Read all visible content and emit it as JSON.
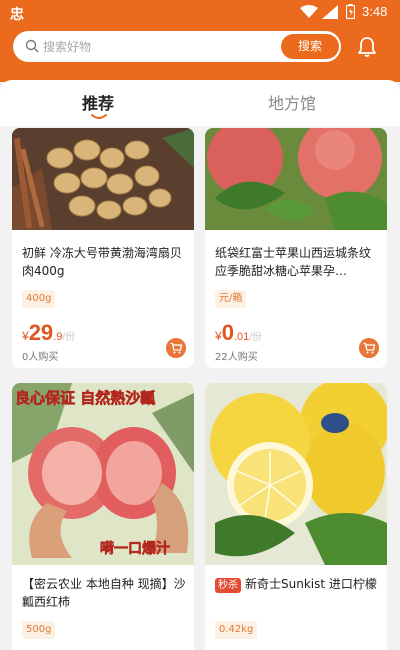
{
  "status_bar": {
    "time": "3:48",
    "app_glyph": "忠"
  },
  "search": {
    "placeholder": "搜索好物",
    "button_label": "搜索"
  },
  "tabs": [
    {
      "label": "推荐"
    },
    {
      "label": "地方馆"
    }
  ],
  "products": [
    {
      "name": "初鲜 冷冻大号带黄渤海湾扇贝肉400g",
      "spec": "400g",
      "price_symbol": "¥",
      "price_int": "29",
      "price_dec": ".9",
      "price_unit": "/份",
      "buyers": "0人购买"
    },
    {
      "name": "纸袋红富士苹果山西运城条纹应季脆甜冰糖心苹果孕…",
      "spec": "元/箱",
      "price_symbol": "¥",
      "price_int": "0",
      "price_dec": ".01",
      "price_unit": "/份",
      "buyers": "22人购买"
    },
    {
      "name": "【密云农业 本地自种 现摘】沙瓤西红柿",
      "spec": "500g",
      "banner_top": "良心保证 自然熟沙瓤",
      "banner_bottom": "嗬一口爆汁"
    },
    {
      "badge": "秒杀",
      "name": "新奇士Sunkist 进口柠檬",
      "spec": "0.42kg"
    }
  ],
  "colors": {
    "brand": "#ec6a1d",
    "price": "#e2551f",
    "spec_bg": "#fdf0e4"
  }
}
